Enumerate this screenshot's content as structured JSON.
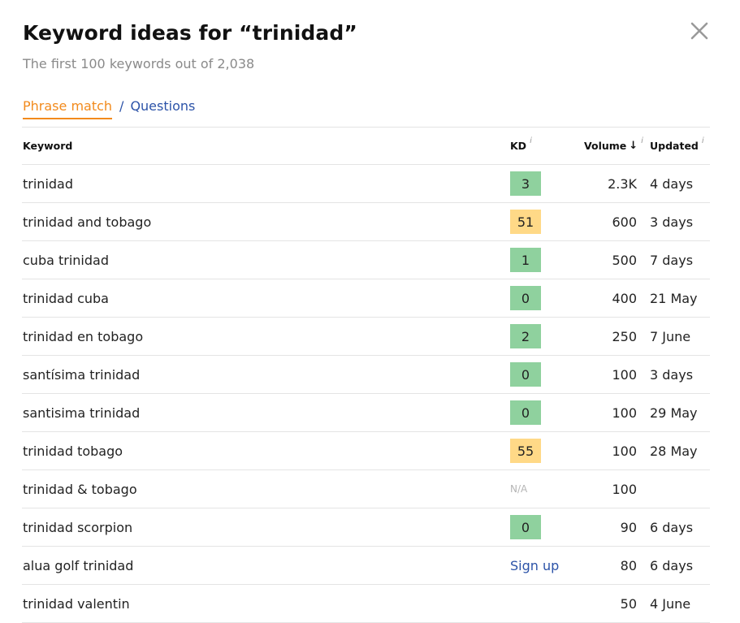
{
  "header": {
    "title": "Keyword ideas for “trinidad”",
    "subtitle": "The first 100 keywords out of 2,038"
  },
  "tabs": {
    "active": "Phrase match",
    "separator": "/",
    "other": "Questions"
  },
  "table": {
    "columns": {
      "keyword": "Keyword",
      "kd": "KD",
      "kd_info": "i",
      "volume": "Volume",
      "volume_sort": "↓",
      "volume_info": "i",
      "updated": "Updated",
      "updated_info": "i"
    },
    "rows": [
      {
        "keyword": "trinidad",
        "kd": "3",
        "kd_color": "green",
        "volume": "2.3K",
        "updated": "4 days"
      },
      {
        "keyword": "trinidad and tobago",
        "kd": "51",
        "kd_color": "yellow",
        "volume": "600",
        "updated": "3 days"
      },
      {
        "keyword": "cuba trinidad",
        "kd": "1",
        "kd_color": "green",
        "volume": "500",
        "updated": "7 days"
      },
      {
        "keyword": "trinidad cuba",
        "kd": "0",
        "kd_color": "green",
        "volume": "400",
        "updated": "21 May"
      },
      {
        "keyword": "trinidad en tobago",
        "kd": "2",
        "kd_color": "green",
        "volume": "250",
        "updated": "7 June"
      },
      {
        "keyword": "santísima trinidad",
        "kd": "0",
        "kd_color": "green",
        "volume": "100",
        "updated": "3 days"
      },
      {
        "keyword": "santisima trinidad",
        "kd": "0",
        "kd_color": "green",
        "volume": "100",
        "updated": "29 May"
      },
      {
        "keyword": "trinidad tobago",
        "kd": "55",
        "kd_color": "yellow",
        "volume": "100",
        "updated": "28 May"
      },
      {
        "keyword": "trinidad & tobago",
        "kd": "N/A",
        "kd_color": "na",
        "volume": "100",
        "updated": ""
      },
      {
        "keyword": "trinidad scorpion",
        "kd": "0",
        "kd_color": "green",
        "volume": "90",
        "updated": "6 days"
      },
      {
        "keyword": "alua golf trinidad",
        "kd": "Sign up",
        "kd_color": "signup",
        "volume": "80",
        "updated": "6 days"
      },
      {
        "keyword": "trinidad valentin",
        "kd": "",
        "kd_color": "none",
        "volume": "50",
        "updated": "4 June"
      }
    ]
  },
  "colors": {
    "accent": "#f28a1c",
    "link": "#2c53a8",
    "kd_green": "#8fd19e",
    "kd_yellow": "#ffd987"
  },
  "icons": {
    "close": "close-icon",
    "sort": "arrow-down-icon",
    "info": "info-icon"
  }
}
